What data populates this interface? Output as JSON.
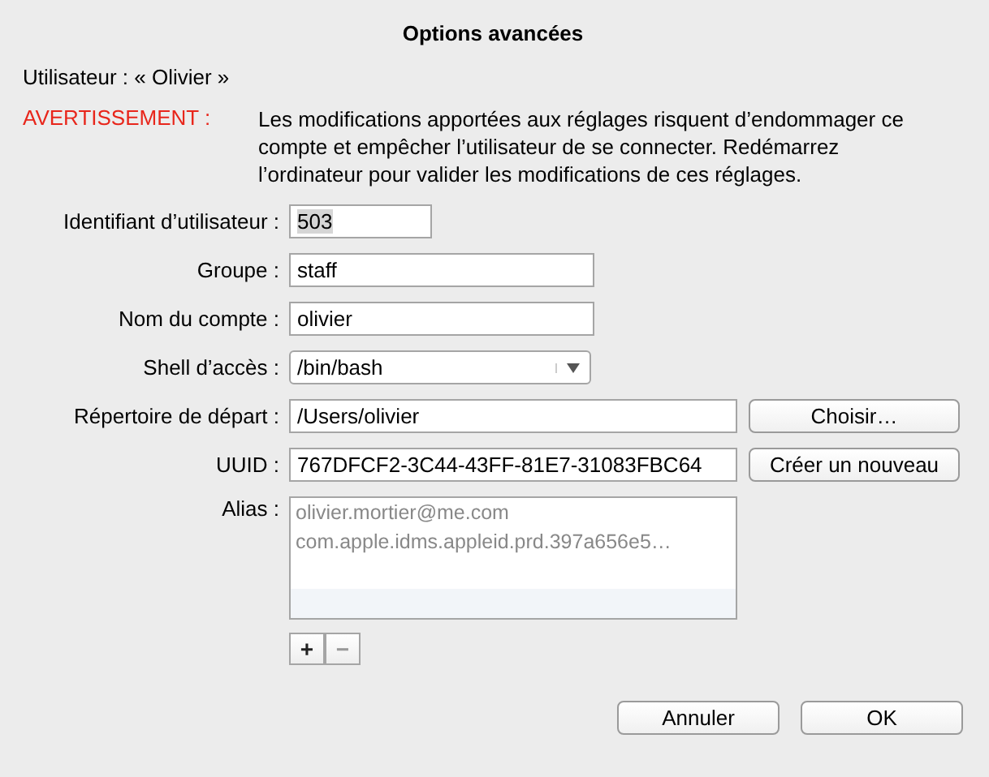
{
  "window": {
    "title": "Options avancées"
  },
  "user_line": "Utilisateur : « Olivier »",
  "warning": {
    "label": "AVERTISSEMENT :",
    "text": "Les modifications apportées aux réglages risquent d’endommager ce compte et empêcher l’utilisateur de se connecter. Redémarrez l’ordinateur pour valider les modifications de ces réglages."
  },
  "fields": [
    {
      "kind": "short",
      "label": "Identifiant d’utilisateur :",
      "value": "503",
      "highlighted": true
    },
    {
      "kind": "medium",
      "label": "Groupe :",
      "value": "staff",
      "highlighted": false
    },
    {
      "kind": "medium",
      "label": "Nom du compte :",
      "value": "olivier",
      "highlighted": false
    },
    {
      "kind": "popup",
      "label": "Shell d’accès :",
      "value": "/bin/bash",
      "highlighted": false
    },
    {
      "kind": "long",
      "label": "Répertoire de départ :",
      "value": "/Users/olivier",
      "button": "Choisir…",
      "highlighted": false
    },
    {
      "kind": "long",
      "label": "UUID :",
      "value": "767DFCF2-3C44-43FF-81E7-31083FBC64",
      "button": "Créer un nouveau",
      "highlighted": false
    }
  ],
  "alias": {
    "label": "Alias :",
    "items": [
      "olivier.mortier@me.com",
      "com.apple.idms.appleid.prd.397a656e5…"
    ]
  },
  "list_buttons": [
    {
      "label": "+",
      "disabled": false
    },
    {
      "label": "−",
      "disabled": true
    }
  ],
  "buttons": [
    "Annuler",
    "OK"
  ]
}
